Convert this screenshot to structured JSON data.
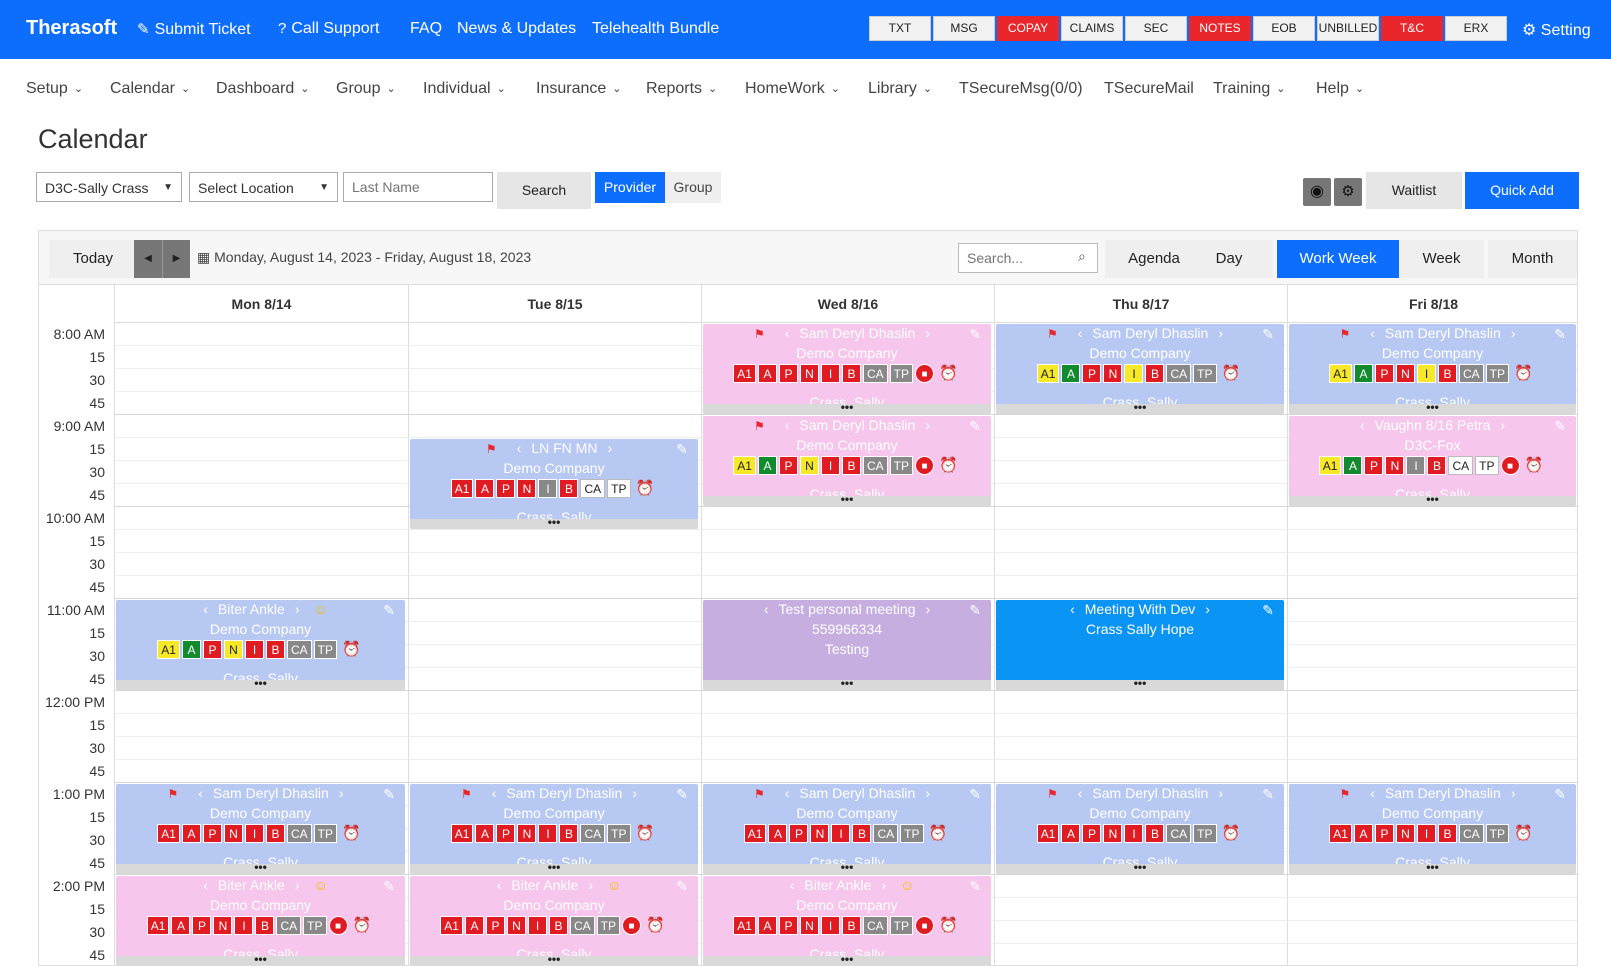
{
  "topbar": {
    "brand": "Therasoft",
    "links": [
      {
        "label": "Submit Ticket",
        "icon": "✎"
      },
      {
        "label": "Call Support",
        "icon": "?"
      },
      {
        "label": "FAQ",
        "icon": ""
      },
      {
        "label": "News & Updates",
        "icon": ""
      },
      {
        "label": "Telehealth Bundle",
        "icon": ""
      }
    ],
    "buttons": [
      {
        "label": "TXT",
        "red": false
      },
      {
        "label": "MSG",
        "red": false
      },
      {
        "label": "COPAY",
        "red": true
      },
      {
        "label": "CLAIMS",
        "red": false
      },
      {
        "label": "SEC",
        "red": false
      },
      {
        "label": "NOTES",
        "red": true
      },
      {
        "label": "EOB",
        "red": false
      },
      {
        "label": "UNBILLED",
        "red": false
      },
      {
        "label": "T&C",
        "red": true
      },
      {
        "label": "ERX",
        "red": false
      }
    ],
    "setting": "Setting"
  },
  "menu": [
    {
      "label": "Setup",
      "chev": true
    },
    {
      "label": "Calendar",
      "chev": true
    },
    {
      "label": "Dashboard",
      "chev": true
    },
    {
      "label": "Group",
      "chev": true
    },
    {
      "label": "Individual",
      "chev": true
    },
    {
      "label": "Insurance",
      "chev": true
    },
    {
      "label": "Reports",
      "chev": true
    },
    {
      "label": "HomeWork",
      "chev": true
    },
    {
      "label": "Library",
      "chev": true
    },
    {
      "label": "TSecureMsg(0/0)",
      "chev": false
    },
    {
      "label": "TSecureMail",
      "chev": false
    },
    {
      "label": "Training",
      "chev": true
    },
    {
      "label": "Help",
      "chev": true
    }
  ],
  "page": {
    "title": "Calendar"
  },
  "filters": {
    "provider_select": "D3C-Sally Crass",
    "location_select": "Select Location",
    "last_name_placeholder": "Last Name",
    "search_button": "Search",
    "provider_toggle": "Provider",
    "group_toggle": "Group",
    "waitlist": "Waitlist",
    "quick_add": "Quick Add"
  },
  "calendar": {
    "today": "Today",
    "date_range": "Monday, August 14, 2023 - Friday, August 18, 2023",
    "search_placeholder": "Search...",
    "views": [
      {
        "label": "Agenda",
        "active": false
      },
      {
        "label": "Day",
        "active": false
      },
      {
        "label": "Work Week",
        "active": true
      },
      {
        "label": "Week",
        "active": false
      },
      {
        "label": "Month",
        "active": false
      }
    ],
    "days": [
      "Mon 8/14",
      "Tue 8/15",
      "Wed 8/16",
      "Thu 8/17",
      "Fri 8/18"
    ],
    "time_labels": [
      "8:00 AM",
      "15",
      "30",
      "45",
      "9:00 AM",
      "15",
      "30",
      "45",
      "10:00 AM",
      "15",
      "30",
      "45",
      "11:00 AM",
      "15",
      "30",
      "45",
      "12:00 PM",
      "15",
      "30",
      "45",
      "1:00 PM",
      "15",
      "30",
      "45",
      "2:00 PM",
      "15",
      "30",
      "45"
    ],
    "events": [
      {
        "day": 2,
        "start": 0,
        "slots": 4,
        "color": "pink",
        "flag": true,
        "smile": false,
        "lines": [
          "Sam Deryl Dhaslin",
          "Demo Company"
        ],
        "badges": [
          "A1:r",
          "A:r",
          "P:r",
          "N:r",
          "I:r",
          "B:r",
          "CA:gr",
          "TP:gr"
        ],
        "cam": true,
        "footer": "Crass, Sally"
      },
      {
        "day": 3,
        "start": 0,
        "slots": 4,
        "color": "blue",
        "flag": true,
        "smile": false,
        "lines": [
          "Sam Deryl Dhaslin",
          "Demo Company"
        ],
        "badges": [
          "A1:y",
          "A:g",
          "P:r",
          "N:r",
          "I:y",
          "B:r",
          "CA:gr",
          "TP:gr"
        ],
        "cam": false,
        "footer": "Crass, Sally"
      },
      {
        "day": 4,
        "start": 0,
        "slots": 4,
        "color": "blue",
        "flag": true,
        "smile": false,
        "lines": [
          "Sam Deryl Dhaslin",
          "Demo Company"
        ],
        "badges": [
          "A1:y",
          "A:g",
          "P:r",
          "N:r",
          "I:y",
          "B:r",
          "CA:gr",
          "TP:gr"
        ],
        "cam": false,
        "footer": "Crass, Sally"
      },
      {
        "day": 1,
        "start": 5,
        "slots": 4,
        "color": "blue",
        "flag": true,
        "smile": false,
        "lines": [
          "LN FN MN",
          "Demo Company"
        ],
        "badges": [
          "A1:r",
          "A:r",
          "P:r",
          "N:r",
          "I:gr",
          "B:r",
          "CA:w",
          "TP:w"
        ],
        "cam": false,
        "footer": "Crass, Sally"
      },
      {
        "day": 2,
        "start": 4,
        "slots": 4,
        "color": "pink",
        "flag": true,
        "smile": false,
        "lines": [
          "Sam Deryl Dhaslin",
          "Demo Company"
        ],
        "badges": [
          "A1:y",
          "A:g",
          "P:r",
          "N:y",
          "I:r",
          "B:r",
          "CA:gr",
          "TP:gr"
        ],
        "cam": true,
        "footer": "Crass, Sally"
      },
      {
        "day": 4,
        "start": 4,
        "slots": 4,
        "color": "pink",
        "flag": false,
        "smile": false,
        "lines": [
          "Vaughn 8/16 Petra",
          "D3C-Fox"
        ],
        "badges": [
          "A1:y",
          "A:g",
          "P:r",
          "N:r",
          "I:gr",
          "B:r",
          "CA:w",
          "TP:w"
        ],
        "cam": true,
        "footer": "Crass, Sally"
      },
      {
        "day": 0,
        "start": 12,
        "slots": 4,
        "color": "blue",
        "flag": false,
        "smile": true,
        "lines": [
          "Biter Ankle",
          "Demo Company"
        ],
        "badges": [
          "A1:y",
          "A:g",
          "P:r",
          "N:y",
          "I:r",
          "B:r",
          "CA:gr",
          "TP:gr"
        ],
        "cam": false,
        "footer": "Crass, Sally"
      },
      {
        "day": 2,
        "start": 12,
        "slots": 4,
        "color": "purple",
        "flag": false,
        "smile": false,
        "lines": [
          "Test personal meeting",
          "559966334",
          "Testing"
        ],
        "badges": [],
        "cam": false,
        "alarm": false,
        "footer": ""
      },
      {
        "day": 3,
        "start": 12,
        "slots": 4,
        "color": "dark",
        "flag": false,
        "smile": false,
        "lines": [
          "Meeting With Dev",
          "Crass Sally Hope"
        ],
        "badges": [],
        "cam": false,
        "alarm": false,
        "footer": ""
      },
      {
        "day": 0,
        "start": 20,
        "slots": 4,
        "color": "blue",
        "flag": true,
        "smile": false,
        "lines": [
          "Sam Deryl Dhaslin",
          "Demo Company"
        ],
        "badges": [
          "A1:r",
          "A:r",
          "P:r",
          "N:r",
          "I:r",
          "B:r",
          "CA:gr",
          "TP:gr"
        ],
        "cam": false,
        "footer": "Crass, Sally"
      },
      {
        "day": 1,
        "start": 20,
        "slots": 4,
        "color": "blue",
        "flag": true,
        "smile": false,
        "lines": [
          "Sam Deryl Dhaslin",
          "Demo Company"
        ],
        "badges": [
          "A1:r",
          "A:r",
          "P:r",
          "N:r",
          "I:r",
          "B:r",
          "CA:gr",
          "TP:gr"
        ],
        "cam": false,
        "footer": "Crass, Sally"
      },
      {
        "day": 2,
        "start": 20,
        "slots": 4,
        "color": "blue",
        "flag": true,
        "smile": false,
        "lines": [
          "Sam Deryl Dhaslin",
          "Demo Company"
        ],
        "badges": [
          "A1:r",
          "A:r",
          "P:r",
          "N:r",
          "I:r",
          "B:r",
          "CA:gr",
          "TP:gr"
        ],
        "cam": false,
        "footer": "Crass, Sally"
      },
      {
        "day": 3,
        "start": 20,
        "slots": 4,
        "color": "blue",
        "flag": true,
        "smile": false,
        "lines": [
          "Sam Deryl Dhaslin",
          "Demo Company"
        ],
        "badges": [
          "A1:r",
          "A:r",
          "P:r",
          "N:r",
          "I:r",
          "B:r",
          "CA:gr",
          "TP:gr"
        ],
        "cam": false,
        "footer": "Crass, Sally"
      },
      {
        "day": 4,
        "start": 20,
        "slots": 4,
        "color": "blue",
        "flag": true,
        "smile": false,
        "lines": [
          "Sam Deryl Dhaslin",
          "Demo Company"
        ],
        "badges": [
          "A1:r",
          "A:r",
          "P:r",
          "N:r",
          "I:r",
          "B:r",
          "CA:gr",
          "TP:gr"
        ],
        "cam": false,
        "footer": "Crass, Sally"
      },
      {
        "day": 0,
        "start": 24,
        "slots": 4,
        "color": "pink",
        "flag": false,
        "smile": true,
        "lines": [
          "Biter Ankle",
          "Demo Company"
        ],
        "badges": [
          "A1:r",
          "A:r",
          "P:r",
          "N:r",
          "I:r",
          "B:r",
          "CA:gr",
          "TP:gr"
        ],
        "cam": true,
        "footer": "Crass, Sally"
      },
      {
        "day": 1,
        "start": 24,
        "slots": 4,
        "color": "pink",
        "flag": false,
        "smile": true,
        "lines": [
          "Biter Ankle",
          "Demo Company"
        ],
        "badges": [
          "A1:r",
          "A:r",
          "P:r",
          "N:r",
          "I:r",
          "B:r",
          "CA:gr",
          "TP:gr"
        ],
        "cam": true,
        "footer": "Crass, Sally"
      },
      {
        "day": 2,
        "start": 24,
        "slots": 4,
        "color": "pink",
        "flag": false,
        "smile": true,
        "lines": [
          "Biter Ankle",
          "Demo Company"
        ],
        "badges": [
          "A1:r",
          "A:r",
          "P:r",
          "N:r",
          "I:r",
          "B:r",
          "CA:gr",
          "TP:gr"
        ],
        "cam": true,
        "footer": "Crass, Sally"
      }
    ]
  },
  "colors": {
    "primary": "#0d6efd",
    "red": "#e8262b",
    "blue_event": "#b7c8f2",
    "pink_event": "#f6c6ec",
    "purple_event": "#c7aee0",
    "meeting_event": "#0a94f3"
  }
}
